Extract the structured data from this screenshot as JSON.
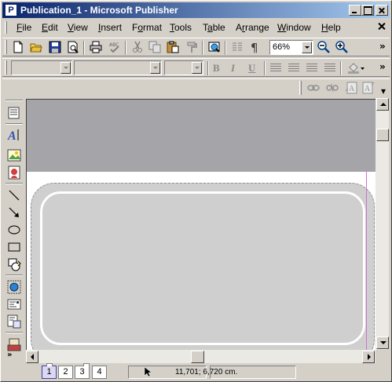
{
  "app": {
    "window_title": "Publication_1 - Microsoft Publisher",
    "icon_letter": "P"
  },
  "menu": {
    "items": [
      {
        "pre": "",
        "u": "F",
        "post": "ile"
      },
      {
        "pre": "",
        "u": "E",
        "post": "dit"
      },
      {
        "pre": "",
        "u": "V",
        "post": "iew"
      },
      {
        "pre": "",
        "u": "I",
        "post": "nsert"
      },
      {
        "pre": "F",
        "u": "o",
        "post": "rmat"
      },
      {
        "pre": "",
        "u": "T",
        "post": "ools"
      },
      {
        "pre": "T",
        "u": "a",
        "post": "ble"
      },
      {
        "pre": "A",
        "u": "r",
        "post": "range"
      },
      {
        "pre": "",
        "u": "W",
        "post": "indow"
      },
      {
        "pre": "",
        "u": "H",
        "post": "elp"
      }
    ]
  },
  "standard_toolbar": {
    "zoom_value": "66%",
    "icons": [
      "new-icon",
      "open-icon",
      "save-icon",
      "print-preview-icon",
      "print-icon",
      "spelling-icon",
      "cut-icon",
      "copy-icon",
      "paste-icon",
      "format-painter-icon",
      "web-preview-icon",
      "columns-icon",
      "special-characters-icon",
      "zoom-out-icon",
      "zoom-in-icon"
    ]
  },
  "formatting_toolbar": {
    "style_value": "",
    "font_value": "",
    "size_value": "",
    "bold": "B",
    "italic": "I",
    "underline": "U"
  },
  "objects_toolbar": {
    "icons": [
      "pointer-icon",
      "text-box-icon",
      "wordart-icon",
      "picture-frame-icon",
      "clip-organizer-icon",
      "line-icon",
      "arrow-icon",
      "oval-icon",
      "rectangle-icon",
      "autoshapes-icon",
      "hot-spot-icon",
      "form-control-icon",
      "html-code-icon",
      "design-gallery-icon"
    ],
    "more_label": "»"
  },
  "status": {
    "pages": [
      "1",
      "2",
      "3",
      "4"
    ],
    "active_page": "1",
    "coordinates": "11,701; 6,720 cm."
  },
  "colors": {
    "title_start": "#0a246a",
    "title_end": "#a6caf0",
    "workspace": "#a5a4a9",
    "shape_fill": "#cfcfcf",
    "margin_guide": "#d070d0"
  }
}
